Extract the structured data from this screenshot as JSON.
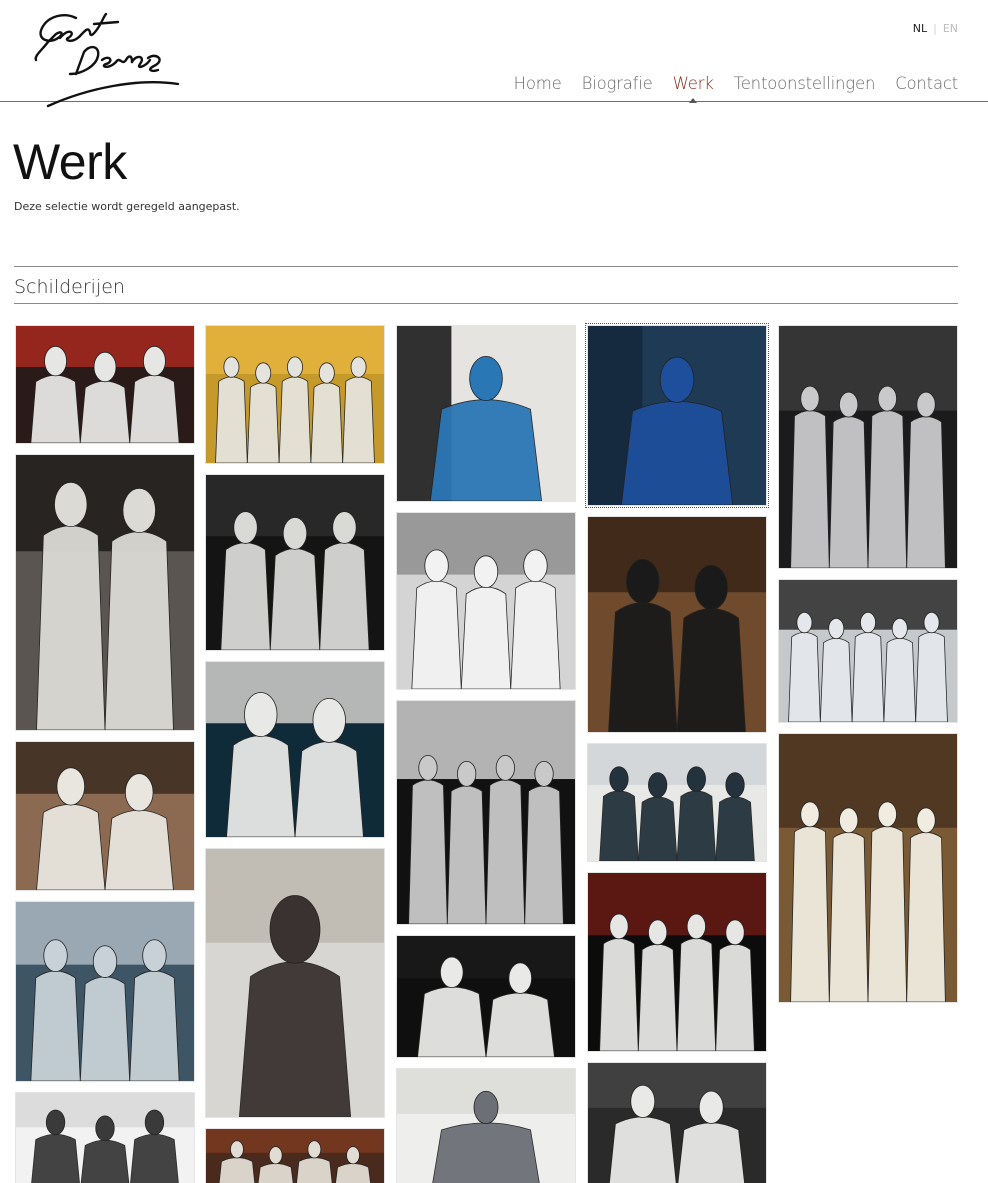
{
  "brand": {
    "logo_alt": "Gert Devos signature"
  },
  "language": {
    "nl": "NL",
    "separator": "|",
    "en": "EN"
  },
  "nav": {
    "items": [
      {
        "label": "Home",
        "active": false
      },
      {
        "label": "Biografie",
        "active": false
      },
      {
        "label": "Werk",
        "active": true
      },
      {
        "label": "Tentoonstellingen",
        "active": false
      },
      {
        "label": "Contact",
        "active": false
      }
    ]
  },
  "page": {
    "title": "Werk",
    "subtitle": "Deze selectie wordt geregeld aangepast."
  },
  "section": {
    "title": "Schilderijen"
  },
  "colors": {
    "accent": "#8b2a1c",
    "nav_text": "#6a6a6a",
    "rule": "#8a8a8a"
  }
}
